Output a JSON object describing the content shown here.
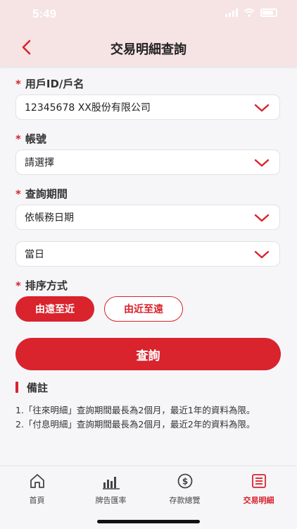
{
  "status_bar": {
    "time": "5:49"
  },
  "header": {
    "title": "交易明細查詢",
    "back_icon": "chevron-left-icon"
  },
  "form": {
    "user": {
      "label": "用戶ID/戶名",
      "value": "12345678 XX股份有限公司"
    },
    "account": {
      "label": "帳號",
      "value": "請選擇"
    },
    "period": {
      "label": "查詢期間",
      "type_value": "依帳務日期",
      "range_value": "當日"
    },
    "sort": {
      "label": "排序方式",
      "options": [
        "由遠至近",
        "由近至遠"
      ],
      "selected": "由遠至近"
    },
    "query_button": "查詢"
  },
  "notes": {
    "title": "備註",
    "items": [
      "1.「往來明細」查詢期間最長為2個月，最近1年的資料為限。",
      "2.「付息明細」查詢期間最長為2個月，最近2年的資料為限。"
    ]
  },
  "tabbar": {
    "items": [
      {
        "label": "首頁",
        "icon": "home-icon"
      },
      {
        "label": "牌告匯率",
        "icon": "bar-chart-icon"
      },
      {
        "label": "存款總覽",
        "icon": "dollar-coin-icon"
      },
      {
        "label": "交易明細",
        "icon": "list-document-icon"
      }
    ],
    "active": "交易明細"
  },
  "colors": {
    "accent": "#d9232d",
    "header_bg": "#f6e3e3",
    "page_bg": "#f6f6f9"
  }
}
